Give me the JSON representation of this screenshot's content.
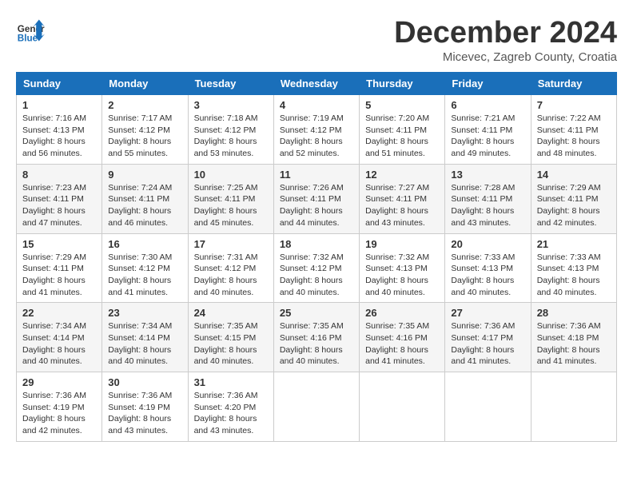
{
  "header": {
    "title": "December 2024",
    "location": "Micevec, Zagreb County, Croatia"
  },
  "logo": {
    "general": "General",
    "blue": "Blue"
  },
  "columns": [
    "Sunday",
    "Monday",
    "Tuesday",
    "Wednesday",
    "Thursday",
    "Friday",
    "Saturday"
  ],
  "weeks": [
    [
      {
        "day": "1",
        "sunrise": "Sunrise: 7:16 AM",
        "sunset": "Sunset: 4:13 PM",
        "daylight": "Daylight: 8 hours and 56 minutes."
      },
      {
        "day": "2",
        "sunrise": "Sunrise: 7:17 AM",
        "sunset": "Sunset: 4:12 PM",
        "daylight": "Daylight: 8 hours and 55 minutes."
      },
      {
        "day": "3",
        "sunrise": "Sunrise: 7:18 AM",
        "sunset": "Sunset: 4:12 PM",
        "daylight": "Daylight: 8 hours and 53 minutes."
      },
      {
        "day": "4",
        "sunrise": "Sunrise: 7:19 AM",
        "sunset": "Sunset: 4:12 PM",
        "daylight": "Daylight: 8 hours and 52 minutes."
      },
      {
        "day": "5",
        "sunrise": "Sunrise: 7:20 AM",
        "sunset": "Sunset: 4:11 PM",
        "daylight": "Daylight: 8 hours and 51 minutes."
      },
      {
        "day": "6",
        "sunrise": "Sunrise: 7:21 AM",
        "sunset": "Sunset: 4:11 PM",
        "daylight": "Daylight: 8 hours and 49 minutes."
      },
      {
        "day": "7",
        "sunrise": "Sunrise: 7:22 AM",
        "sunset": "Sunset: 4:11 PM",
        "daylight": "Daylight: 8 hours and 48 minutes."
      }
    ],
    [
      {
        "day": "8",
        "sunrise": "Sunrise: 7:23 AM",
        "sunset": "Sunset: 4:11 PM",
        "daylight": "Daylight: 8 hours and 47 minutes."
      },
      {
        "day": "9",
        "sunrise": "Sunrise: 7:24 AM",
        "sunset": "Sunset: 4:11 PM",
        "daylight": "Daylight: 8 hours and 46 minutes."
      },
      {
        "day": "10",
        "sunrise": "Sunrise: 7:25 AM",
        "sunset": "Sunset: 4:11 PM",
        "daylight": "Daylight: 8 hours and 45 minutes."
      },
      {
        "day": "11",
        "sunrise": "Sunrise: 7:26 AM",
        "sunset": "Sunset: 4:11 PM",
        "daylight": "Daylight: 8 hours and 44 minutes."
      },
      {
        "day": "12",
        "sunrise": "Sunrise: 7:27 AM",
        "sunset": "Sunset: 4:11 PM",
        "daylight": "Daylight: 8 hours and 43 minutes."
      },
      {
        "day": "13",
        "sunrise": "Sunrise: 7:28 AM",
        "sunset": "Sunset: 4:11 PM",
        "daylight": "Daylight: 8 hours and 43 minutes."
      },
      {
        "day": "14",
        "sunrise": "Sunrise: 7:29 AM",
        "sunset": "Sunset: 4:11 PM",
        "daylight": "Daylight: 8 hours and 42 minutes."
      }
    ],
    [
      {
        "day": "15",
        "sunrise": "Sunrise: 7:29 AM",
        "sunset": "Sunset: 4:11 PM",
        "daylight": "Daylight: 8 hours and 41 minutes."
      },
      {
        "day": "16",
        "sunrise": "Sunrise: 7:30 AM",
        "sunset": "Sunset: 4:12 PM",
        "daylight": "Daylight: 8 hours and 41 minutes."
      },
      {
        "day": "17",
        "sunrise": "Sunrise: 7:31 AM",
        "sunset": "Sunset: 4:12 PM",
        "daylight": "Daylight: 8 hours and 40 minutes."
      },
      {
        "day": "18",
        "sunrise": "Sunrise: 7:32 AM",
        "sunset": "Sunset: 4:12 PM",
        "daylight": "Daylight: 8 hours and 40 minutes."
      },
      {
        "day": "19",
        "sunrise": "Sunrise: 7:32 AM",
        "sunset": "Sunset: 4:13 PM",
        "daylight": "Daylight: 8 hours and 40 minutes."
      },
      {
        "day": "20",
        "sunrise": "Sunrise: 7:33 AM",
        "sunset": "Sunset: 4:13 PM",
        "daylight": "Daylight: 8 hours and 40 minutes."
      },
      {
        "day": "21",
        "sunrise": "Sunrise: 7:33 AM",
        "sunset": "Sunset: 4:13 PM",
        "daylight": "Daylight: 8 hours and 40 minutes."
      }
    ],
    [
      {
        "day": "22",
        "sunrise": "Sunrise: 7:34 AM",
        "sunset": "Sunset: 4:14 PM",
        "daylight": "Daylight: 8 hours and 40 minutes."
      },
      {
        "day": "23",
        "sunrise": "Sunrise: 7:34 AM",
        "sunset": "Sunset: 4:14 PM",
        "daylight": "Daylight: 8 hours and 40 minutes."
      },
      {
        "day": "24",
        "sunrise": "Sunrise: 7:35 AM",
        "sunset": "Sunset: 4:15 PM",
        "daylight": "Daylight: 8 hours and 40 minutes."
      },
      {
        "day": "25",
        "sunrise": "Sunrise: 7:35 AM",
        "sunset": "Sunset: 4:16 PM",
        "daylight": "Daylight: 8 hours and 40 minutes."
      },
      {
        "day": "26",
        "sunrise": "Sunrise: 7:35 AM",
        "sunset": "Sunset: 4:16 PM",
        "daylight": "Daylight: 8 hours and 41 minutes."
      },
      {
        "day": "27",
        "sunrise": "Sunrise: 7:36 AM",
        "sunset": "Sunset: 4:17 PM",
        "daylight": "Daylight: 8 hours and 41 minutes."
      },
      {
        "day": "28",
        "sunrise": "Sunrise: 7:36 AM",
        "sunset": "Sunset: 4:18 PM",
        "daylight": "Daylight: 8 hours and 41 minutes."
      }
    ],
    [
      {
        "day": "29",
        "sunrise": "Sunrise: 7:36 AM",
        "sunset": "Sunset: 4:19 PM",
        "daylight": "Daylight: 8 hours and 42 minutes."
      },
      {
        "day": "30",
        "sunrise": "Sunrise: 7:36 AM",
        "sunset": "Sunset: 4:19 PM",
        "daylight": "Daylight: 8 hours and 43 minutes."
      },
      {
        "day": "31",
        "sunrise": "Sunrise: 7:36 AM",
        "sunset": "Sunset: 4:20 PM",
        "daylight": "Daylight: 8 hours and 43 minutes."
      },
      null,
      null,
      null,
      null
    ]
  ]
}
